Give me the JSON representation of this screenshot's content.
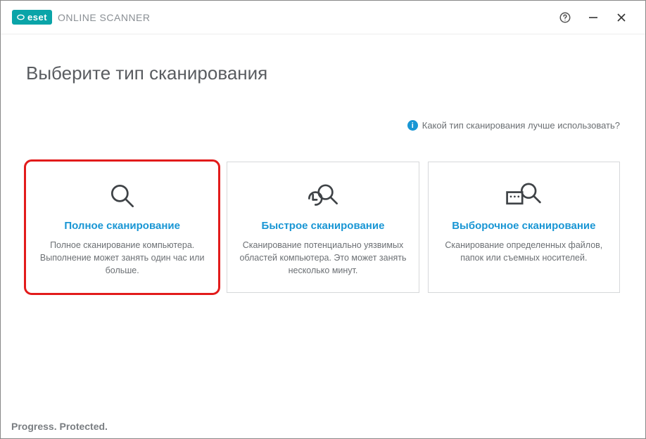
{
  "brand": {
    "logo_text": "eset",
    "product": "ONLINE SCANNER"
  },
  "page": {
    "title": "Выберите тип сканирования"
  },
  "hint": {
    "text": "Какой тип сканирования лучше использовать?"
  },
  "cards": {
    "full": {
      "title": "Полное сканирование",
      "desc": "Полное сканирование компьютера. Выполнение может занять один час или больше."
    },
    "quick": {
      "title": "Быстрое сканирование",
      "desc": "Сканирование потенциально уязвимых областей компьютера. Это может занять несколько минут."
    },
    "custom": {
      "title": "Выборочное сканирование",
      "desc": "Сканирование определенных файлов, папок или съемных носителей."
    }
  },
  "footer": {
    "tagline": "Progress. Protected."
  }
}
